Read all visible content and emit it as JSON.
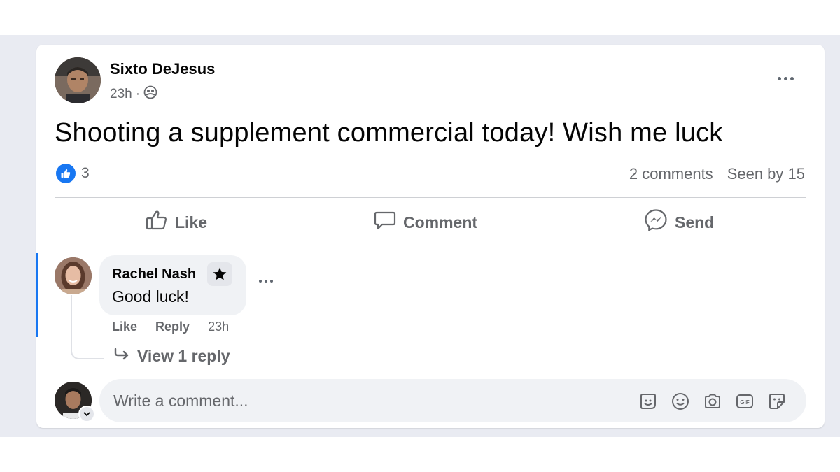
{
  "post": {
    "author": "Sixto DeJesus",
    "time": "23h",
    "separator": "·",
    "audience_icon": "friends-icon",
    "text": "Shooting a supplement commercial today! Wish me luck",
    "reaction_icon": "like-icon",
    "reaction_count": "3",
    "comments_count": "2 comments",
    "seen_by": "Seen by 15"
  },
  "actions": {
    "like": "Like",
    "comment": "Comment",
    "send": "Send"
  },
  "comment": {
    "author": "Rachel Nash",
    "badge_icon": "star-icon",
    "text": "Good luck!",
    "like": "Like",
    "reply": "Reply",
    "time": "23h"
  },
  "replies": {
    "label": "View 1 reply"
  },
  "composer": {
    "placeholder": "Write a comment...",
    "tools": [
      "avatar-sticker-icon",
      "emoji-icon",
      "camera-icon",
      "gif-icon",
      "sticker-icon"
    ]
  },
  "colors": {
    "accent": "#1877f2",
    "muted_text": "#65676b",
    "page_band": "#e9ebf2",
    "bubble": "#f0f2f5"
  }
}
